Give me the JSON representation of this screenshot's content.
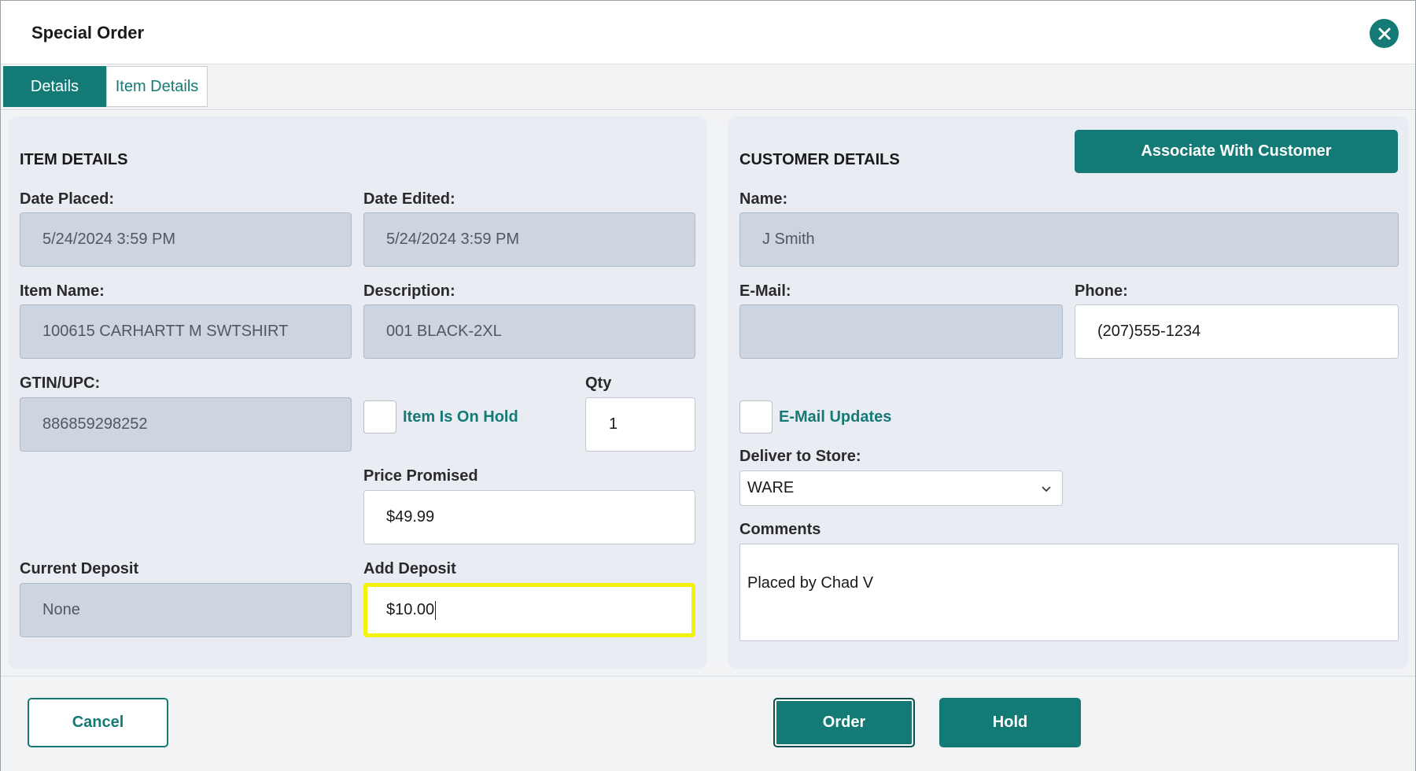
{
  "dialog": {
    "title": "Special Order"
  },
  "tabs": [
    {
      "label": "Details",
      "active": true
    },
    {
      "label": "Item Details",
      "active": false
    }
  ],
  "item_details": {
    "section_title": "ITEM DETAILS",
    "date_placed": {
      "label": "Date Placed:",
      "value": "5/24/2024 3:59 PM"
    },
    "date_edited": {
      "label": "Date Edited:",
      "value": "5/24/2024 3:59 PM"
    },
    "item_name": {
      "label": "Item Name:",
      "value": "100615 CARHARTT M SWTSHIRT"
    },
    "description": {
      "label": "Description:",
      "value": "001 BLACK-2XL"
    },
    "gtin": {
      "label": "GTIN/UPC:",
      "value": "886859298252"
    },
    "on_hold": {
      "label": "Item Is On Hold",
      "checked": false
    },
    "qty": {
      "label": "Qty",
      "value": "1"
    },
    "price_promised": {
      "label": "Price Promised",
      "value": "$49.99"
    },
    "current_deposit": {
      "label": "Current Deposit",
      "value": "None"
    },
    "add_deposit": {
      "label": "Add Deposit",
      "value": "$10.00"
    }
  },
  "customer_details": {
    "section_title": "CUSTOMER DETAILS",
    "associate_label": "Associate With Customer",
    "name": {
      "label": "Name:",
      "value": "J Smith"
    },
    "email": {
      "label": "E-Mail:",
      "value": ""
    },
    "phone": {
      "label": "Phone:",
      "value": "(207)555-1234"
    },
    "email_updates": {
      "label": "E-Mail Updates",
      "checked": false
    },
    "deliver_to_store": {
      "label": "Deliver to Store:",
      "value": "WARE"
    },
    "comments": {
      "label": "Comments",
      "value": "Placed by Chad V"
    }
  },
  "footer": {
    "cancel_label": "Cancel",
    "order_label": "Order",
    "hold_label": "Hold"
  },
  "colors": {
    "accent": "#137a76",
    "readonly_field": "#cdd5e1",
    "panel": "#e9ecf3",
    "focus_highlight": "#f2f20a"
  }
}
